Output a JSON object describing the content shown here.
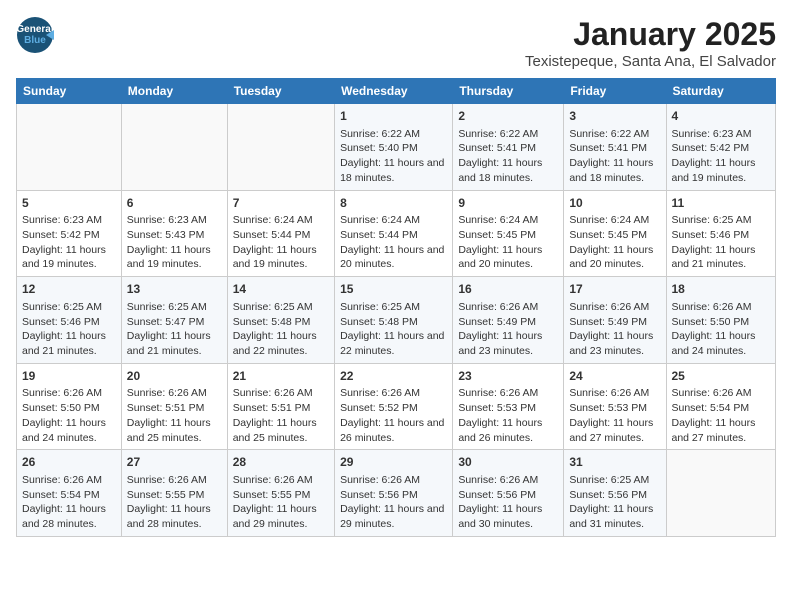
{
  "logo": {
    "line1": "General",
    "line2": "Blue"
  },
  "title": "January 2025",
  "subtitle": "Texistepeque, Santa Ana, El Salvador",
  "days_of_week": [
    "Sunday",
    "Monday",
    "Tuesday",
    "Wednesday",
    "Thursday",
    "Friday",
    "Saturday"
  ],
  "weeks": [
    [
      {
        "day": "",
        "content": ""
      },
      {
        "day": "",
        "content": ""
      },
      {
        "day": "",
        "content": ""
      },
      {
        "day": "1",
        "content": "Sunrise: 6:22 AM\nSunset: 5:40 PM\nDaylight: 11 hours and 18 minutes."
      },
      {
        "day": "2",
        "content": "Sunrise: 6:22 AM\nSunset: 5:41 PM\nDaylight: 11 hours and 18 minutes."
      },
      {
        "day": "3",
        "content": "Sunrise: 6:22 AM\nSunset: 5:41 PM\nDaylight: 11 hours and 18 minutes."
      },
      {
        "day": "4",
        "content": "Sunrise: 6:23 AM\nSunset: 5:42 PM\nDaylight: 11 hours and 19 minutes."
      }
    ],
    [
      {
        "day": "5",
        "content": "Sunrise: 6:23 AM\nSunset: 5:42 PM\nDaylight: 11 hours and 19 minutes."
      },
      {
        "day": "6",
        "content": "Sunrise: 6:23 AM\nSunset: 5:43 PM\nDaylight: 11 hours and 19 minutes."
      },
      {
        "day": "7",
        "content": "Sunrise: 6:24 AM\nSunset: 5:44 PM\nDaylight: 11 hours and 19 minutes."
      },
      {
        "day": "8",
        "content": "Sunrise: 6:24 AM\nSunset: 5:44 PM\nDaylight: 11 hours and 20 minutes."
      },
      {
        "day": "9",
        "content": "Sunrise: 6:24 AM\nSunset: 5:45 PM\nDaylight: 11 hours and 20 minutes."
      },
      {
        "day": "10",
        "content": "Sunrise: 6:24 AM\nSunset: 5:45 PM\nDaylight: 11 hours and 20 minutes."
      },
      {
        "day": "11",
        "content": "Sunrise: 6:25 AM\nSunset: 5:46 PM\nDaylight: 11 hours and 21 minutes."
      }
    ],
    [
      {
        "day": "12",
        "content": "Sunrise: 6:25 AM\nSunset: 5:46 PM\nDaylight: 11 hours and 21 minutes."
      },
      {
        "day": "13",
        "content": "Sunrise: 6:25 AM\nSunset: 5:47 PM\nDaylight: 11 hours and 21 minutes."
      },
      {
        "day": "14",
        "content": "Sunrise: 6:25 AM\nSunset: 5:48 PM\nDaylight: 11 hours and 22 minutes."
      },
      {
        "day": "15",
        "content": "Sunrise: 6:25 AM\nSunset: 5:48 PM\nDaylight: 11 hours and 22 minutes."
      },
      {
        "day": "16",
        "content": "Sunrise: 6:26 AM\nSunset: 5:49 PM\nDaylight: 11 hours and 23 minutes."
      },
      {
        "day": "17",
        "content": "Sunrise: 6:26 AM\nSunset: 5:49 PM\nDaylight: 11 hours and 23 minutes."
      },
      {
        "day": "18",
        "content": "Sunrise: 6:26 AM\nSunset: 5:50 PM\nDaylight: 11 hours and 24 minutes."
      }
    ],
    [
      {
        "day": "19",
        "content": "Sunrise: 6:26 AM\nSunset: 5:50 PM\nDaylight: 11 hours and 24 minutes."
      },
      {
        "day": "20",
        "content": "Sunrise: 6:26 AM\nSunset: 5:51 PM\nDaylight: 11 hours and 25 minutes."
      },
      {
        "day": "21",
        "content": "Sunrise: 6:26 AM\nSunset: 5:51 PM\nDaylight: 11 hours and 25 minutes."
      },
      {
        "day": "22",
        "content": "Sunrise: 6:26 AM\nSunset: 5:52 PM\nDaylight: 11 hours and 26 minutes."
      },
      {
        "day": "23",
        "content": "Sunrise: 6:26 AM\nSunset: 5:53 PM\nDaylight: 11 hours and 26 minutes."
      },
      {
        "day": "24",
        "content": "Sunrise: 6:26 AM\nSunset: 5:53 PM\nDaylight: 11 hours and 27 minutes."
      },
      {
        "day": "25",
        "content": "Sunrise: 6:26 AM\nSunset: 5:54 PM\nDaylight: 11 hours and 27 minutes."
      }
    ],
    [
      {
        "day": "26",
        "content": "Sunrise: 6:26 AM\nSunset: 5:54 PM\nDaylight: 11 hours and 28 minutes."
      },
      {
        "day": "27",
        "content": "Sunrise: 6:26 AM\nSunset: 5:55 PM\nDaylight: 11 hours and 28 minutes."
      },
      {
        "day": "28",
        "content": "Sunrise: 6:26 AM\nSunset: 5:55 PM\nDaylight: 11 hours and 29 minutes."
      },
      {
        "day": "29",
        "content": "Sunrise: 6:26 AM\nSunset: 5:56 PM\nDaylight: 11 hours and 29 minutes."
      },
      {
        "day": "30",
        "content": "Sunrise: 6:26 AM\nSunset: 5:56 PM\nDaylight: 11 hours and 30 minutes."
      },
      {
        "day": "31",
        "content": "Sunrise: 6:25 AM\nSunset: 5:56 PM\nDaylight: 11 hours and 31 minutes."
      },
      {
        "day": "",
        "content": ""
      }
    ]
  ]
}
